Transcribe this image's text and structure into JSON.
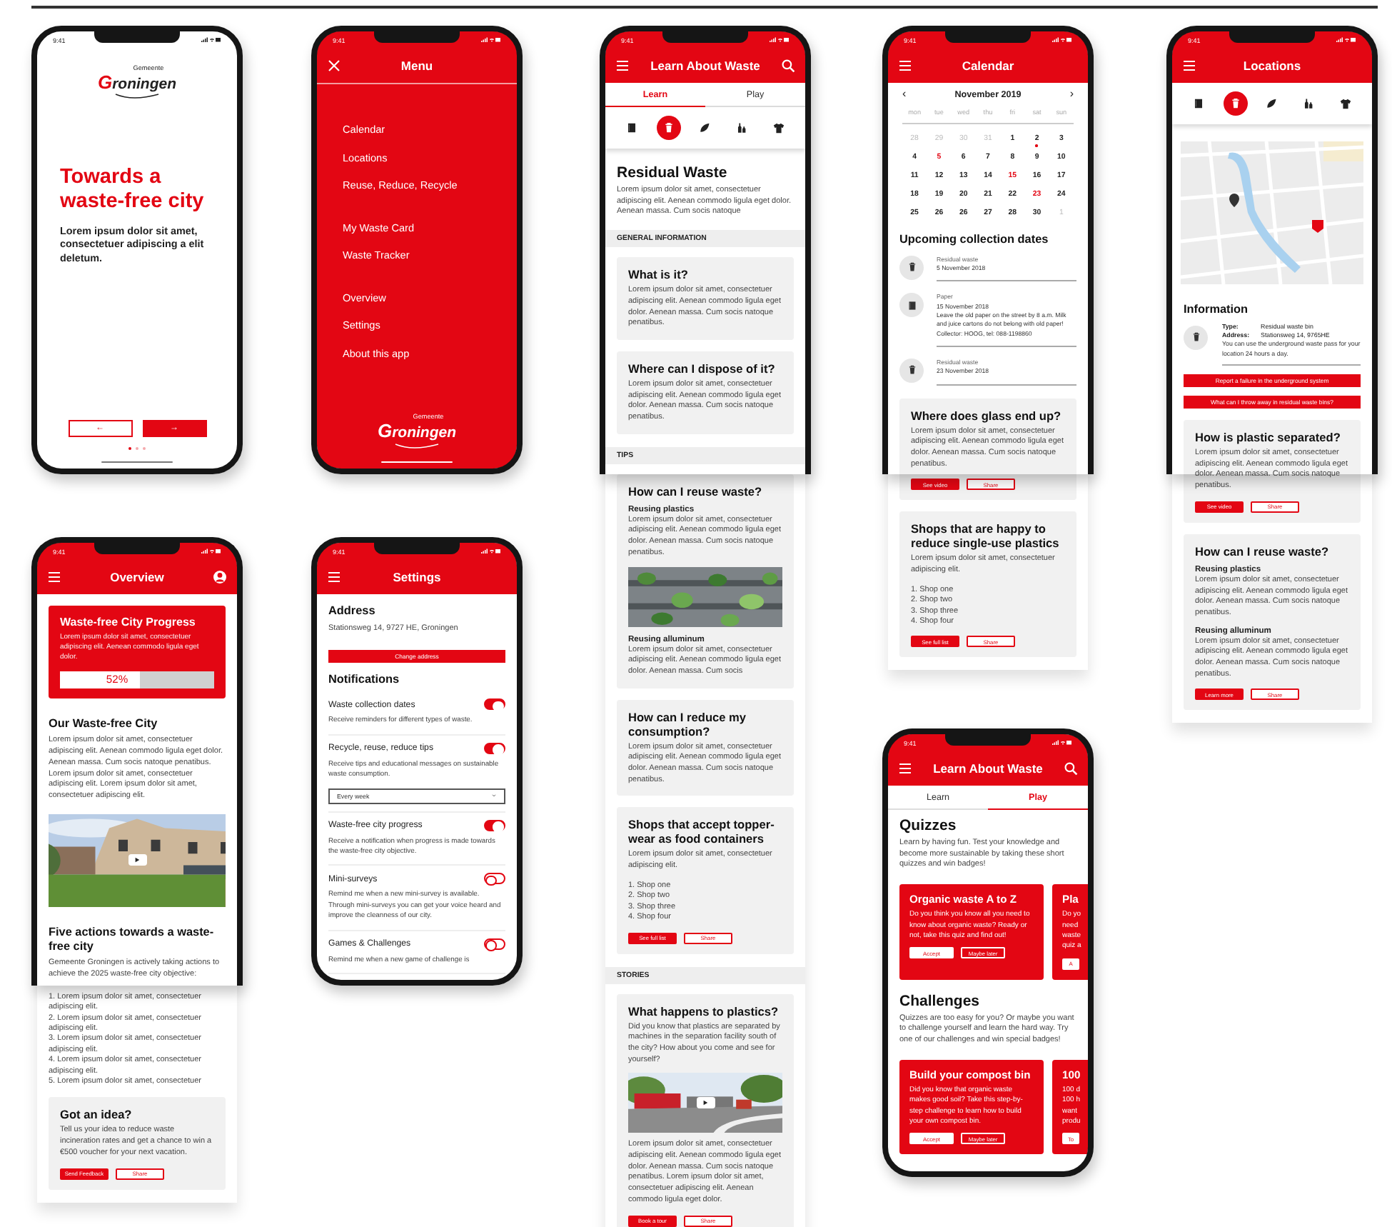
{
  "screens": [
    {
      "kind": "onboarding",
      "time": "9:41",
      "blocks": [
        {
          "kind": "logo",
          "subtitle": "Gemeente",
          "wordmark": "Groningen"
        },
        {
          "kind": "hero",
          "text": "Towards a waste-free city"
        },
        {
          "kind": "lead",
          "text": "Lorem ipsum dolor sit amet, consectetuer adipiscing a elit deletum."
        },
        {
          "kind": "pager",
          "prev": "←",
          "next": "→",
          "dots": [
            {
              "selected": true
            },
            {
              "selected": false
            },
            {
              "selected": false
            }
          ]
        }
      ]
    },
    {
      "kind": "menu",
      "time": "9:41",
      "header": {
        "title": "Menu"
      },
      "blocks": [
        {
          "kind": "menu",
          "groups": [
            {
              "items": [
                "Calendar",
                "Locations",
                "Reuse, Reduce, Recycle"
              ]
            },
            {
              "items": [
                "My Waste Card",
                "Waste Tracker"
              ]
            },
            {
              "items": [
                "Overview",
                "Settings",
                "About this app"
              ]
            }
          ]
        },
        {
          "kind": "logo",
          "subtitle": "Gemeente",
          "wordmark": "Groningen"
        }
      ]
    },
    {
      "kind": "learn",
      "time": "9:41",
      "header": {
        "title": "Learn About Waste"
      },
      "blocks": [
        {
          "kind": "tabs",
          "tabs": [
            {
              "label": "Learn",
              "selected": true
            },
            {
              "label": "Play",
              "selected": false
            }
          ]
        },
        {
          "kind": "categories",
          "items": [
            {
              "selected": false
            },
            {
              "selected": true
            },
            {
              "selected": false
            },
            {
              "selected": false
            },
            {
              "selected": false
            }
          ]
        },
        {
          "kind": "title",
          "text": "Residual Waste"
        },
        {
          "kind": "text",
          "text": "Lorem ipsum dolor sit amet, consectetuer adipiscing elit. Aenean commodo ligula eget dolor. Aenean massa. Cum socis natoque"
        },
        {
          "kind": "section",
          "text": "GENERAL INFORMATION"
        },
        {
          "kind": "card",
          "title": "What is it?",
          "parts": [
            {
              "kind": "text",
              "text": "Lorem ipsum dolor sit amet, consectetuer adipiscing elit. Aenean commodo ligula eget dolor. Aenean massa. Cum socis natoque penatibus."
            }
          ]
        },
        {
          "kind": "card",
          "title": "Where can I dispose of it?",
          "parts": [
            {
              "kind": "text",
              "text": "Lorem ipsum dolor sit amet, consectetuer adipiscing elit. Aenean commodo ligula eget dolor. Aenean massa. Cum socis natoque penatibus."
            }
          ]
        },
        {
          "kind": "section",
          "text": "TIPS"
        },
        {
          "kind": "card",
          "title": "How can I reuse waste?",
          "parts": [
            {
              "kind": "text",
              "subtitle": "Reusing plastics",
              "text": "Lorem ipsum dolor sit amet, consectetuer adipiscing elit. Aenean commodo ligula eget dolor. Aenean massa. Cum socis natoque penatibus."
            },
            {
              "kind": "picture",
              "video": false
            },
            {
              "kind": "text",
              "subtitle": "Reusing alluminum",
              "text": "Lorem ipsum dolor sit amet, consectetuer adipiscing elit. Aenean commodo ligula eget dolor. Aenean massa. Cum socis"
            }
          ]
        },
        {
          "kind": "card",
          "title": "How can I reduce my consumption?",
          "parts": [
            {
              "kind": "text",
              "text": "Lorem ipsum dolor sit amet, consectetuer adipiscing elit. Aenean commodo ligula eget dolor. Aenean massa. Cum socis natoque penatibus."
            }
          ]
        },
        {
          "kind": "card",
          "title": "Shops that accept topper-wear as food containers",
          "parts": [
            {
              "kind": "text",
              "text": "Lorem ipsum dolor sit amet, consectetuer adipiscing elit."
            },
            {
              "kind": "list",
              "items": [
                "1. Shop one",
                "2. Shop two",
                "3. Shop three",
                "4. Shop four"
              ]
            }
          ],
          "buttons": [
            {
              "label": "See full list",
              "kind": "primary"
            },
            {
              "label": "Share",
              "kind": "secondary"
            }
          ]
        },
        {
          "kind": "section",
          "text": "STORIES"
        },
        {
          "kind": "card",
          "title": "What happens to plastics?",
          "parts": [
            {
              "kind": "text",
              "text": "Did you know that plastics are separated by machines in the separation facility south of the city? How about you come and see for yourself?"
            },
            {
              "kind": "picture",
              "video": true
            },
            {
              "kind": "text",
              "text": "Lorem ipsum dolor sit amet, consectetuer adipiscing elit. Aenean commodo ligula eget dolor. Aenean massa. Cum socis natoque penatibus. Lorem ipsum dolor sit amet, consectetuer adipiscing elit. Aenean commodo ligula eget dolor."
            }
          ],
          "buttons": [
            {
              "label": "Book a tour",
              "kind": "primary"
            },
            {
              "label": "Share",
              "kind": "secondary"
            }
          ]
        }
      ]
    },
    {
      "kind": "calendar",
      "time": "9:41",
      "header": {
        "title": "Calendar"
      },
      "blocks": [
        {
          "kind": "calendar",
          "month": "November 2019",
          "prev": "‹",
          "next": "›",
          "weekdays": [
            "mon",
            "tue",
            "wed",
            "thu",
            "fri",
            "sat",
            "sun"
          ],
          "days": [
            {
              "label": "28",
              "kind": "other"
            },
            {
              "label": "29",
              "kind": "other"
            },
            {
              "label": "30",
              "kind": "other"
            },
            {
              "label": "31",
              "kind": "other"
            },
            {
              "label": "1",
              "kind": "day"
            },
            {
              "label": "2",
              "kind": "today"
            },
            {
              "label": "3",
              "kind": "day"
            },
            {
              "label": "4",
              "kind": "day"
            },
            {
              "label": "5",
              "kind": "collection"
            },
            {
              "label": "6",
              "kind": "day"
            },
            {
              "label": "7",
              "kind": "day"
            },
            {
              "label": "8",
              "kind": "day"
            },
            {
              "label": "9",
              "kind": "day"
            },
            {
              "label": "10",
              "kind": "day"
            },
            {
              "label": "11",
              "kind": "day"
            },
            {
              "label": "12",
              "kind": "day"
            },
            {
              "label": "13",
              "kind": "day"
            },
            {
              "label": "14",
              "kind": "day"
            },
            {
              "label": "15",
              "kind": "collection"
            },
            {
              "label": "16",
              "kind": "day"
            },
            {
              "label": "17",
              "kind": "day"
            },
            {
              "label": "18",
              "kind": "day"
            },
            {
              "label": "19",
              "kind": "day"
            },
            {
              "label": "20",
              "kind": "day"
            },
            {
              "label": "21",
              "kind": "day"
            },
            {
              "label": "22",
              "kind": "day"
            },
            {
              "label": "23",
              "kind": "collection"
            },
            {
              "label": "24",
              "kind": "day"
            },
            {
              "label": "25",
              "kind": "day"
            },
            {
              "label": "26",
              "kind": "day"
            },
            {
              "label": "26",
              "kind": "day"
            },
            {
              "label": "27",
              "kind": "day"
            },
            {
              "label": "28",
              "kind": "day"
            },
            {
              "label": "30",
              "kind": "day"
            },
            {
              "label": "1",
              "kind": "other"
            }
          ]
        },
        {
          "kind": "heading",
          "text": "Upcoming collection dates"
        },
        {
          "kind": "events",
          "items": [
            {
              "kind": "residual",
              "lines": [
                "Residual waste",
                "5 November 2018"
              ]
            },
            {
              "kind": "paper",
              "lines": [
                "Paper",
                "15 November 2018",
                "Leave the old paper on the street by 8 a.m. Milk and juice cartons do not belong with old paper!",
                "Collector: HOOG, tel: 088-1198860"
              ]
            },
            {
              "kind": "residual",
              "lines": [
                "Residual waste",
                "23 November 2018"
              ]
            }
          ]
        },
        {
          "kind": "card",
          "title": "Where does glass end up?",
          "parts": [
            {
              "kind": "text",
              "text": "Lorem ipsum dolor sit amet, consectetuer adipiscing elit. Aenean commodo ligula eget dolor. Aenean massa. Cum socis natoque penatibus."
            }
          ],
          "buttons": [
            {
              "label": "See video",
              "kind": "primary"
            },
            {
              "label": "Share",
              "kind": "secondary"
            }
          ]
        },
        {
          "kind": "card",
          "title": "Shops that are happy to reduce single-use plastics",
          "parts": [
            {
              "kind": "text",
              "text": "Lorem ipsum dolor sit amet, consectetuer adipiscing elit."
            },
            {
              "kind": "list",
              "items": [
                "1. Shop one",
                "2. Shop two",
                "3. Shop three",
                "4. Shop four"
              ]
            }
          ],
          "buttons": [
            {
              "label": "See full list",
              "kind": "primary"
            },
            {
              "label": "Share",
              "kind": "secondary"
            }
          ]
        }
      ]
    },
    {
      "kind": "locations",
      "time": "9:41",
      "header": {
        "title": "Locations"
      },
      "blocks": [
        {
          "kind": "categories",
          "items": [
            {
              "selected": false
            },
            {
              "selected": true
            },
            {
              "selected": false
            },
            {
              "selected": false
            },
            {
              "selected": false
            }
          ]
        },
        {
          "kind": "map"
        },
        {
          "kind": "info",
          "title": "Information",
          "rows": [
            {
              "label": "Type:",
              "value": "Residual waste bin"
            },
            {
              "label": "Address:",
              "value": "Stationsweg 14, 9765HE"
            }
          ],
          "note": "You can use the underground waste pass for your location 24 hours a day."
        },
        {
          "kind": "wide_button",
          "label": "Report a failure in the underground system"
        },
        {
          "kind": "wide_button",
          "label": "What can I throw away in residual waste bins?"
        },
        {
          "kind": "card",
          "title": "How is plastic separated?",
          "parts": [
            {
              "kind": "text",
              "text": "Lorem ipsum dolor sit amet, consectetuer adipiscing elit. Aenean commodo ligula eget dolor. Aenean massa. Cum socis natoque penatibus."
            }
          ],
          "buttons": [
            {
              "label": "See video",
              "kind": "primary"
            },
            {
              "label": "Share",
              "kind": "secondary"
            }
          ]
        },
        {
          "kind": "card",
          "title": "How can I reuse waste?",
          "parts": [
            {
              "kind": "text",
              "subtitle": "Reusing plastics",
              "text": "Lorem ipsum dolor sit amet, consectetuer adipiscing elit. Aenean commodo ligula eget dolor. Aenean massa. Cum socis natoque penatibus."
            },
            {
              "kind": "text",
              "subtitle": "Reusing alluminum",
              "text": "Lorem ipsum dolor sit amet, consectetuer adipiscing elit. Aenean commodo ligula eget dolor. Aenean massa. Cum socis natoque penatibus."
            }
          ],
          "buttons": [
            {
              "label": "Learn more",
              "kind": "primary"
            },
            {
              "label": "Share",
              "kind": "secondary"
            }
          ]
        }
      ]
    },
    {
      "kind": "overview",
      "time": "9:41",
      "header": {
        "title": "Overview"
      },
      "blocks": [
        {
          "kind": "progress",
          "title": "Waste-free City Progress",
          "text": "Lorem ipsum dolor sit amet, consectetuer adipiscing elit. Aenean commodo ligula eget dolor.",
          "level": 0.52,
          "reading": "52%"
        },
        {
          "kind": "heading",
          "text": "Our Waste-free City"
        },
        {
          "kind": "text",
          "text": "Lorem ipsum dolor sit amet, consectetuer adipiscing elit. Aenean commodo ligula eget dolor. Aenean massa. Cum socis natoque penatibus. Lorem ipsum dolor sit amet, consectetuer adipiscing elit. Lorem ipsum dolor sit amet, consectetuer adipiscing elit."
        },
        {
          "kind": "picture",
          "video": true
        },
        {
          "kind": "heading",
          "text": "Five actions towards a waste-free city"
        },
        {
          "kind": "text",
          "text": "Gemeente Groningen is actively taking actions to achieve the 2025 waste-free city objective:"
        },
        {
          "kind": "list",
          "items": [
            "1. Lorem ipsum dolor sit amet, consectetuer adipiscing elit.",
            "2. Lorem ipsum dolor sit amet, consectetuer adipiscing elit.",
            "3. Lorem ipsum dolor sit amet, consectetuer adipiscing elit.",
            "4. Lorem ipsum dolor sit amet, consectetuer adipiscing elit.",
            "5. Lorem ipsum dolor sit amet, consectetuer"
          ]
        },
        {
          "kind": "card",
          "title": "Got an idea?",
          "parts": [
            {
              "kind": "text",
              "text": "Tell us your idea to reduce waste incineration rates and get a chance to win a €500 voucher for your next vacation."
            }
          ],
          "buttons": [
            {
              "label": "Send Feedback",
              "kind": "primary"
            },
            {
              "label": "Share",
              "kind": "secondary"
            }
          ]
        }
      ]
    },
    {
      "kind": "settings",
      "time": "9:41",
      "header": {
        "title": "Settings"
      },
      "blocks": [
        {
          "kind": "heading",
          "text": "Address"
        },
        {
          "kind": "text",
          "text": "Stationsweg 14, 9727 HE, Groningen"
        },
        {
          "kind": "wide_button",
          "label": "Change address"
        },
        {
          "kind": "heading",
          "text": "Notifications"
        },
        {
          "kind": "toggle",
          "label": "Waste collection dates",
          "text": "Receive reminders for different types of waste.",
          "on": true
        },
        {
          "kind": "toggle",
          "label": "Recycle, reuse, reduce tips",
          "text": "Receive tips and educational messages on sustainable waste consumption.",
          "on": true,
          "select": "Every week"
        },
        {
          "kind": "toggle",
          "label": "Waste-free city progress",
          "text": "Receive a notification when progress is made towards the waste-free city objective.",
          "on": true
        },
        {
          "kind": "toggle",
          "label": "Mini-surveys",
          "text": "Remind me when a new mini-survey is available. Through mini-surveys you can get your voice heard and improve the cleanness of our city.",
          "on": false
        },
        {
          "kind": "toggle",
          "label": "Games & Challenges",
          "text": "Remind me when a new game of challenge is",
          "on": false
        }
      ]
    },
    {
      "kind": "play",
      "time": "9:41",
      "header": {
        "title": "Learn About Waste"
      },
      "blocks": [
        {
          "kind": "tabs",
          "tabs": [
            {
              "label": "Learn",
              "selected": false
            },
            {
              "label": "Play",
              "selected": true
            }
          ]
        },
        {
          "kind": "title",
          "text": "Quizzes"
        },
        {
          "kind": "text",
          "text": "Learn by having fun. Test your knowledge and become more sustainable by taking these short quizzes and win badges!"
        },
        {
          "kind": "carousel",
          "cards": [
            {
              "kind": "full",
              "title": "Organic waste A to Z",
              "text": "Do you think you know all you need to know about organic waste? Ready or not, take this quiz and find out!",
              "buttons": [
                {
                  "label": "Accept",
                  "kind": "light"
                },
                {
                  "label": "Maybe later",
                  "kind": "outline"
                }
              ]
            },
            {
              "kind": "clipped",
              "title": "Pla",
              "lines": [
                "Do yo",
                "need",
                "waste",
                "quiz a"
              ],
              "buttons": [
                {
                  "label": "A",
                  "kind": "light"
                }
              ]
            }
          ]
        },
        {
          "kind": "title",
          "text": "Challenges"
        },
        {
          "kind": "text",
          "text": "Quizzes are too easy for you? Or maybe you want to challenge yourself and learn the hard way. Try one of our challenges and win special badges!"
        },
        {
          "kind": "carousel",
          "cards": [
            {
              "kind": "full",
              "title": "Build your compost bin",
              "text": "Did you know that organic waste makes good soil? Take this step-by-step challenge to learn how to build your own compost bin.",
              "buttons": [
                {
                  "label": "Accept",
                  "kind": "light"
                },
                {
                  "label": "Maybe later",
                  "kind": "outline"
                }
              ]
            },
            {
              "kind": "clipped",
              "title": "100",
              "lines": [
                "100 d",
                "100 h",
                "want",
                "produ"
              ],
              "buttons": [
                {
                  "label": "To",
                  "kind": "light"
                }
              ]
            }
          ]
        }
      ]
    }
  ]
}
